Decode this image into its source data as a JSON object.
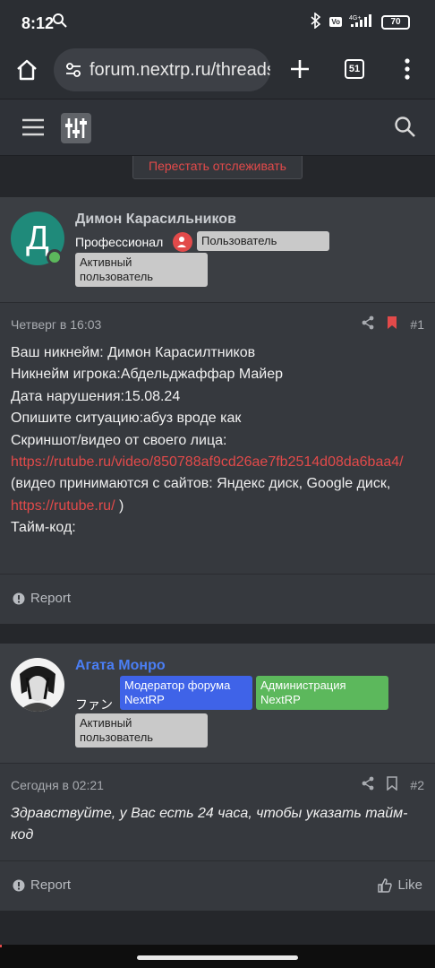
{
  "status": {
    "time": "8:12",
    "battery": "70",
    "net": "4G+"
  },
  "browser": {
    "url": "forum.nextrp.ru/threads",
    "tabs": "51"
  },
  "unwatch_label": "Перестать отслеживать",
  "posts": [
    {
      "avatar_letter": "Д",
      "username": "Димон Карасильников",
      "user_title": "Профессионал",
      "badges": [
        "Пользователь",
        "Активный пользователь"
      ],
      "date": "Четверг в 16:03",
      "number": "#1",
      "lines": {
        "l1": "Ваш никнейм: Димон Карасилтников",
        "l2": "Никнейм игрока:Абдельджаффар Майер",
        "l3": "Дата нарушения:15.08.24",
        "l4": "Опишите ситуацию:абуз вроде как",
        "l5": "Скриншот/видео от своего лица:",
        "link1": "https://rutube.ru/video/850788af9cd26ae7fb2514d08da6baa4/",
        "l6a": "(видео принимаются с сайтов: Яндекс диск, Google диск, ",
        "link2": "https://rutube.ru/",
        "l6b": " )",
        "l7": "Тайм-код:"
      },
      "report": "Report"
    },
    {
      "username": "Агата Монро",
      "user_title": "ファン",
      "badges": [
        "Модератор форума NextRP",
        "Администрация NextRP",
        "Активный пользователь"
      ],
      "date": "Сегодня в 02:21",
      "number": "#2",
      "text": "Здравствуйте, у Вас есть 24 часа, чтобы указать тайм-код",
      "report": "Report",
      "like": "Like"
    }
  ],
  "colors": {
    "accent": "#e24a4a",
    "mod_badge": "#3f63e8",
    "admin_badge": "#5cb85c",
    "name_link": "#4a7ef5"
  }
}
